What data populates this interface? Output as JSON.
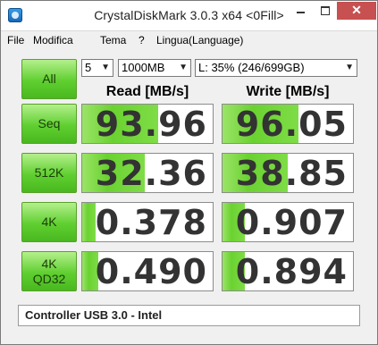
{
  "window": {
    "title": "CrystalDiskMark 3.0.3 x64 <0Fill>",
    "close_label": "✕"
  },
  "menu": {
    "items": [
      "File",
      "Modifica",
      "Tema",
      "?",
      "Lingua(Language)"
    ]
  },
  "controls": {
    "all_label": "All",
    "runs": "5",
    "size": "1000MB",
    "drive": "L: 35% (246/699GB)"
  },
  "columns": {
    "read": "Read [MB/s]",
    "write": "Write [MB/s]"
  },
  "rows": [
    {
      "label": "Seq",
      "label2": "",
      "read": "93.96",
      "write": "96.05",
      "read_fill": 0.58,
      "write_fill": 0.58
    },
    {
      "label": "512K",
      "label2": "",
      "read": "32.36",
      "write": "38.85",
      "read_fill": 0.48,
      "write_fill": 0.5
    },
    {
      "label": "4K",
      "label2": "",
      "read": "0.378",
      "write": "0.907",
      "read_fill": 0.1,
      "write_fill": 0.17
    },
    {
      "label": "4K",
      "label2": "QD32",
      "read": "0.490",
      "write": "0.894",
      "read_fill": 0.12,
      "write_fill": 0.17
    }
  ],
  "comment": "Controller USB 3.0 -  Intel",
  "colors": {
    "accent_green": "#6ad230",
    "close_red": "#c75050"
  }
}
